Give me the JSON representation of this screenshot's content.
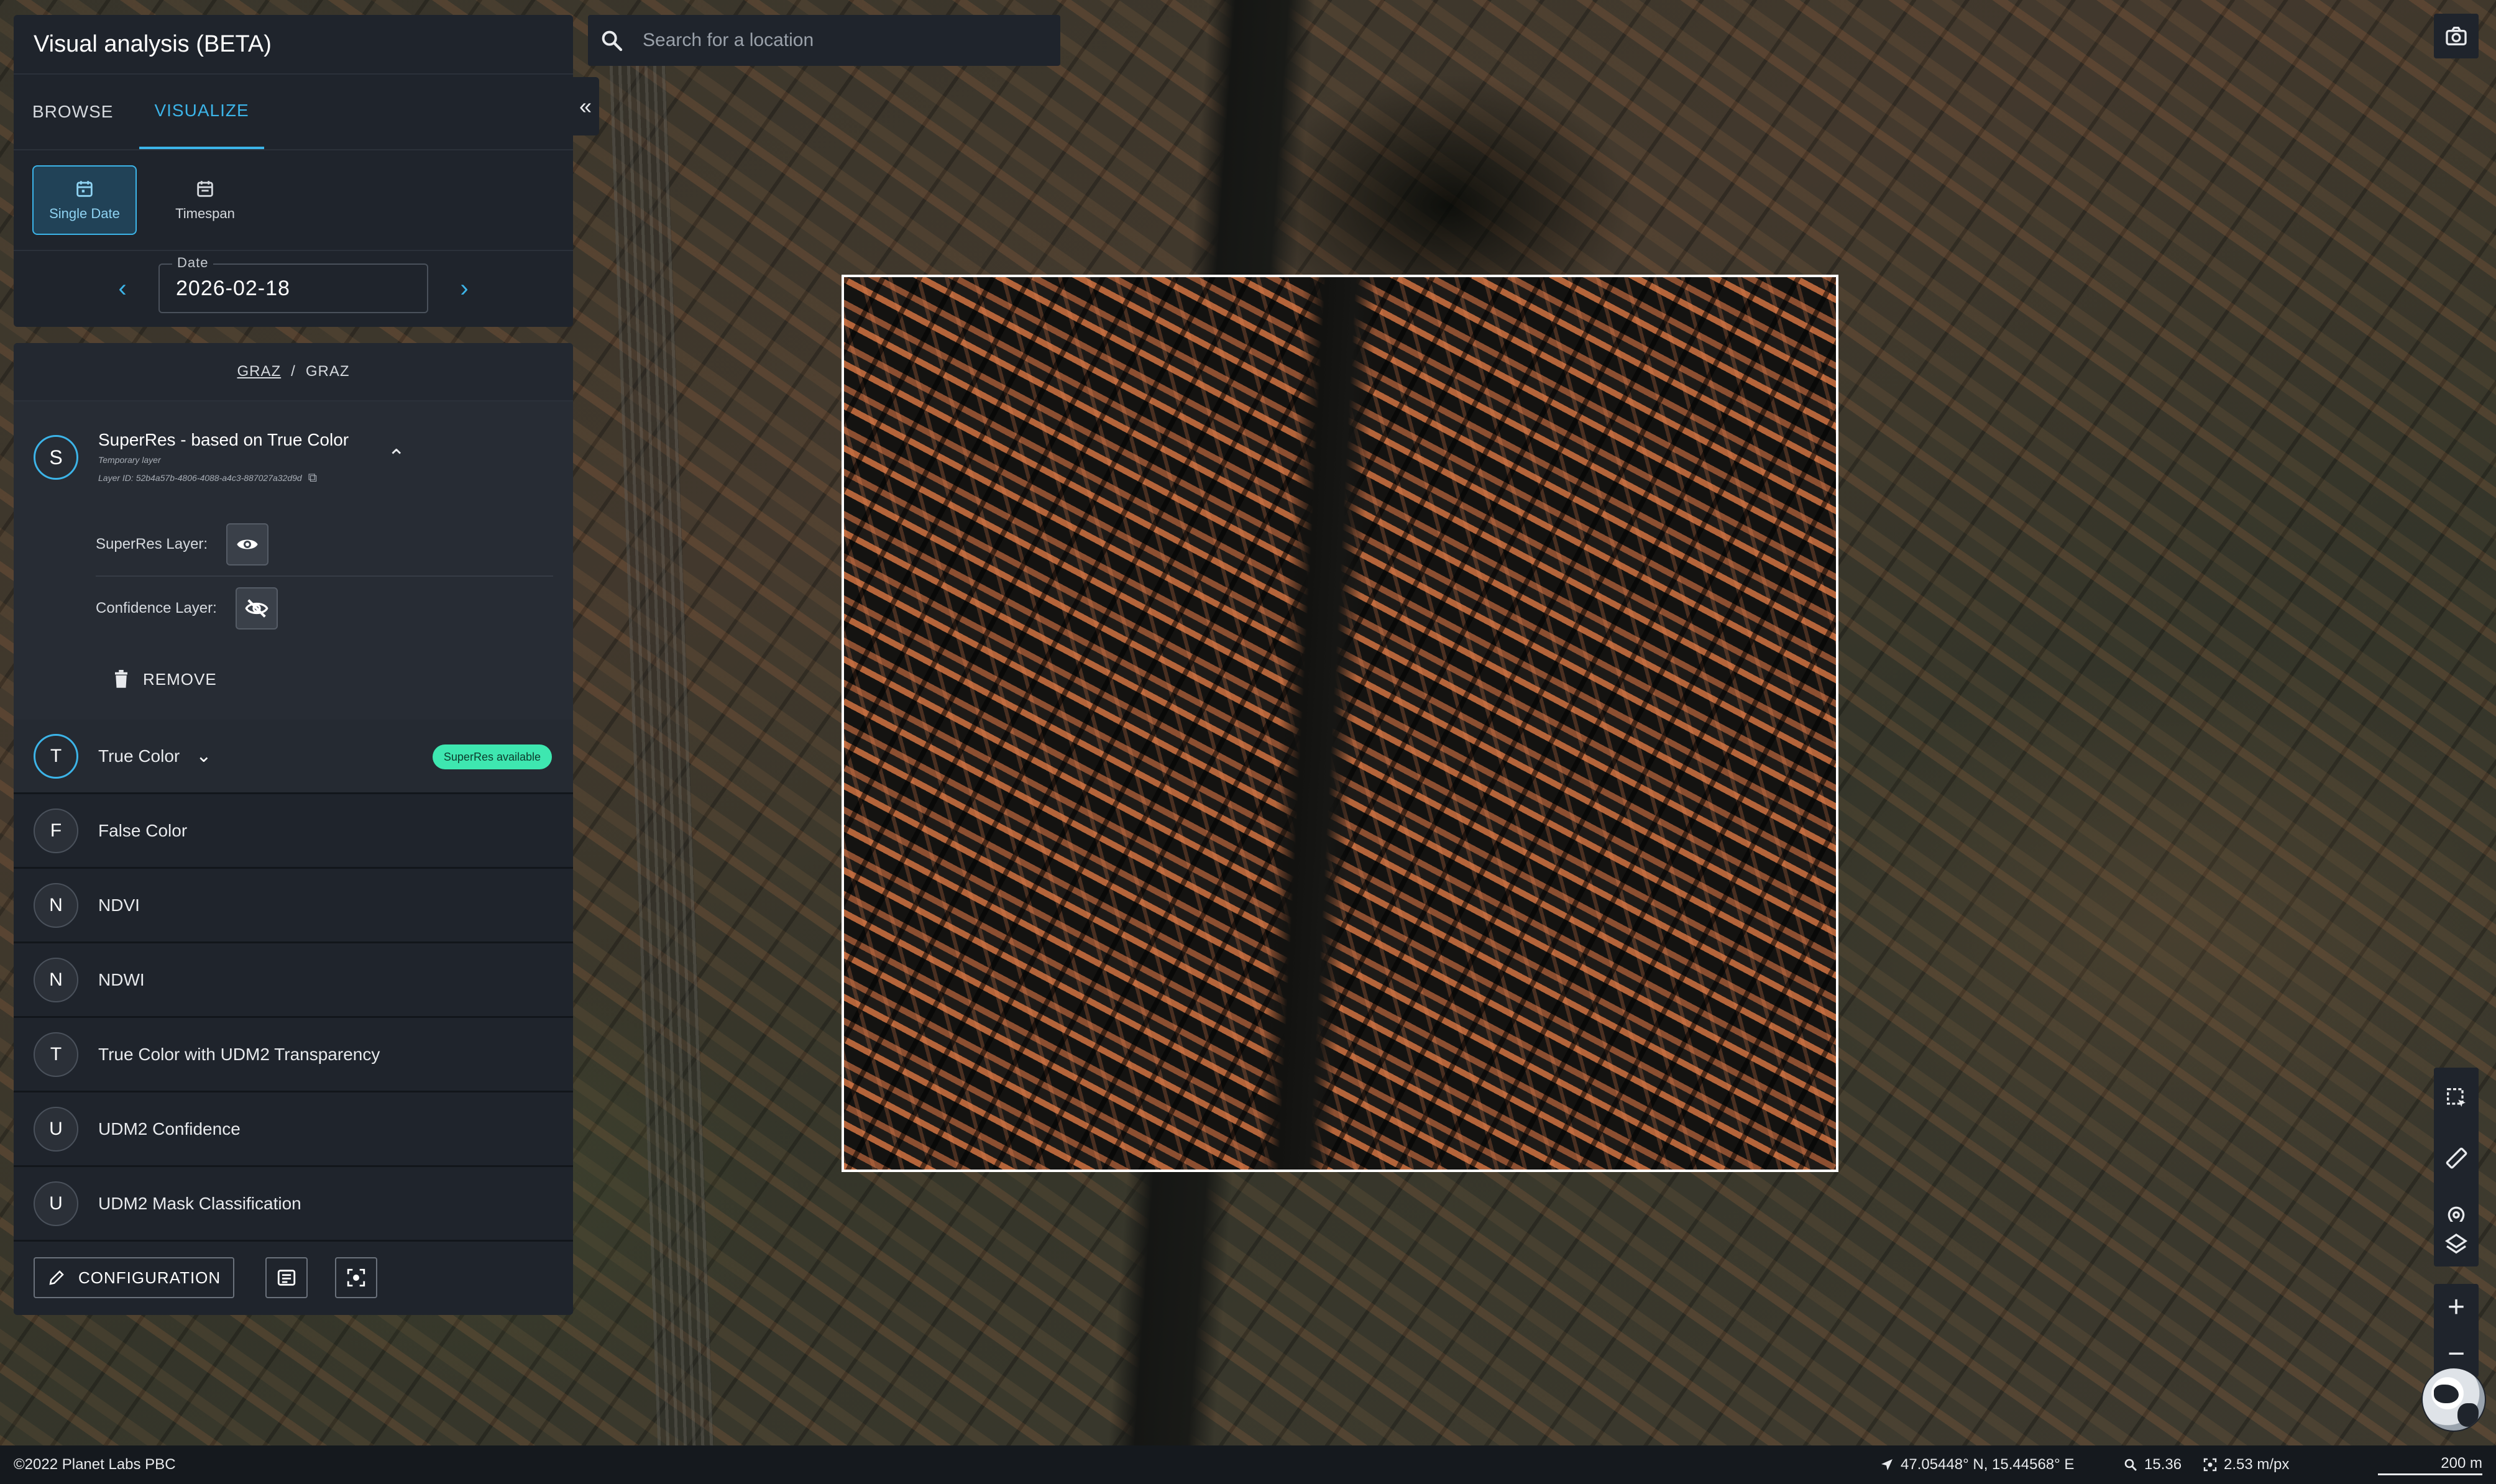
{
  "app": {
    "title": "Visual analysis (BETA)",
    "tabs": [
      {
        "label": "BROWSE",
        "active": false
      },
      {
        "label": "VISUALIZE",
        "active": true
      }
    ],
    "collapse_icon": "double-chevron-left-icon"
  },
  "modes": [
    {
      "label": "Single Date",
      "icon": "calendar-icon",
      "active": true
    },
    {
      "label": "Timespan",
      "icon": "calendar-range-icon",
      "active": false
    }
  ],
  "date": {
    "label": "Date",
    "value": "2026-02-18",
    "prev_icon": "chevron-left-icon",
    "next_icon": "chevron-right-icon"
  },
  "breadcrumb": {
    "first": "GRAZ",
    "separator": "/",
    "second": "GRAZ"
  },
  "superres": {
    "avatar": "S",
    "title": "SuperRes - based on True Color",
    "subtitle": "Temporary layer",
    "layer_id": "Layer ID: 52b4a57b-4806-4088-a4c3-887027a32d9d",
    "superres_layer_label": "SuperRes Layer:",
    "confidence_layer_label": "Confidence Layer:",
    "remove_label": "REMOVE"
  },
  "layers": [
    {
      "avatar": "T",
      "name": "True Color",
      "badge": "SuperRes available",
      "current": true
    },
    {
      "avatar": "F",
      "name": "False Color"
    },
    {
      "avatar": "N",
      "name": "NDVI"
    },
    {
      "avatar": "N",
      "name": "NDWI"
    },
    {
      "avatar": "T",
      "name": "True Color with UDM2 Transparency"
    },
    {
      "avatar": "U",
      "name": "UDM2 Confidence"
    },
    {
      "avatar": "U",
      "name": "UDM2 Mask Classification"
    }
  ],
  "footer": {
    "configuration_label": "CONFIGURATION"
  },
  "search": {
    "placeholder": "Search for a location"
  },
  "status": {
    "copyright": "©2022 Planet Labs PBC",
    "coordinates": "47.05448° N, 15.44568° E",
    "zoom": "15.36",
    "resolution": "2.53 m/px",
    "scale": "200 m"
  },
  "colors": {
    "accent": "#3cb4e8",
    "badge": "#3ee7b0",
    "panel": "#1f242c"
  }
}
